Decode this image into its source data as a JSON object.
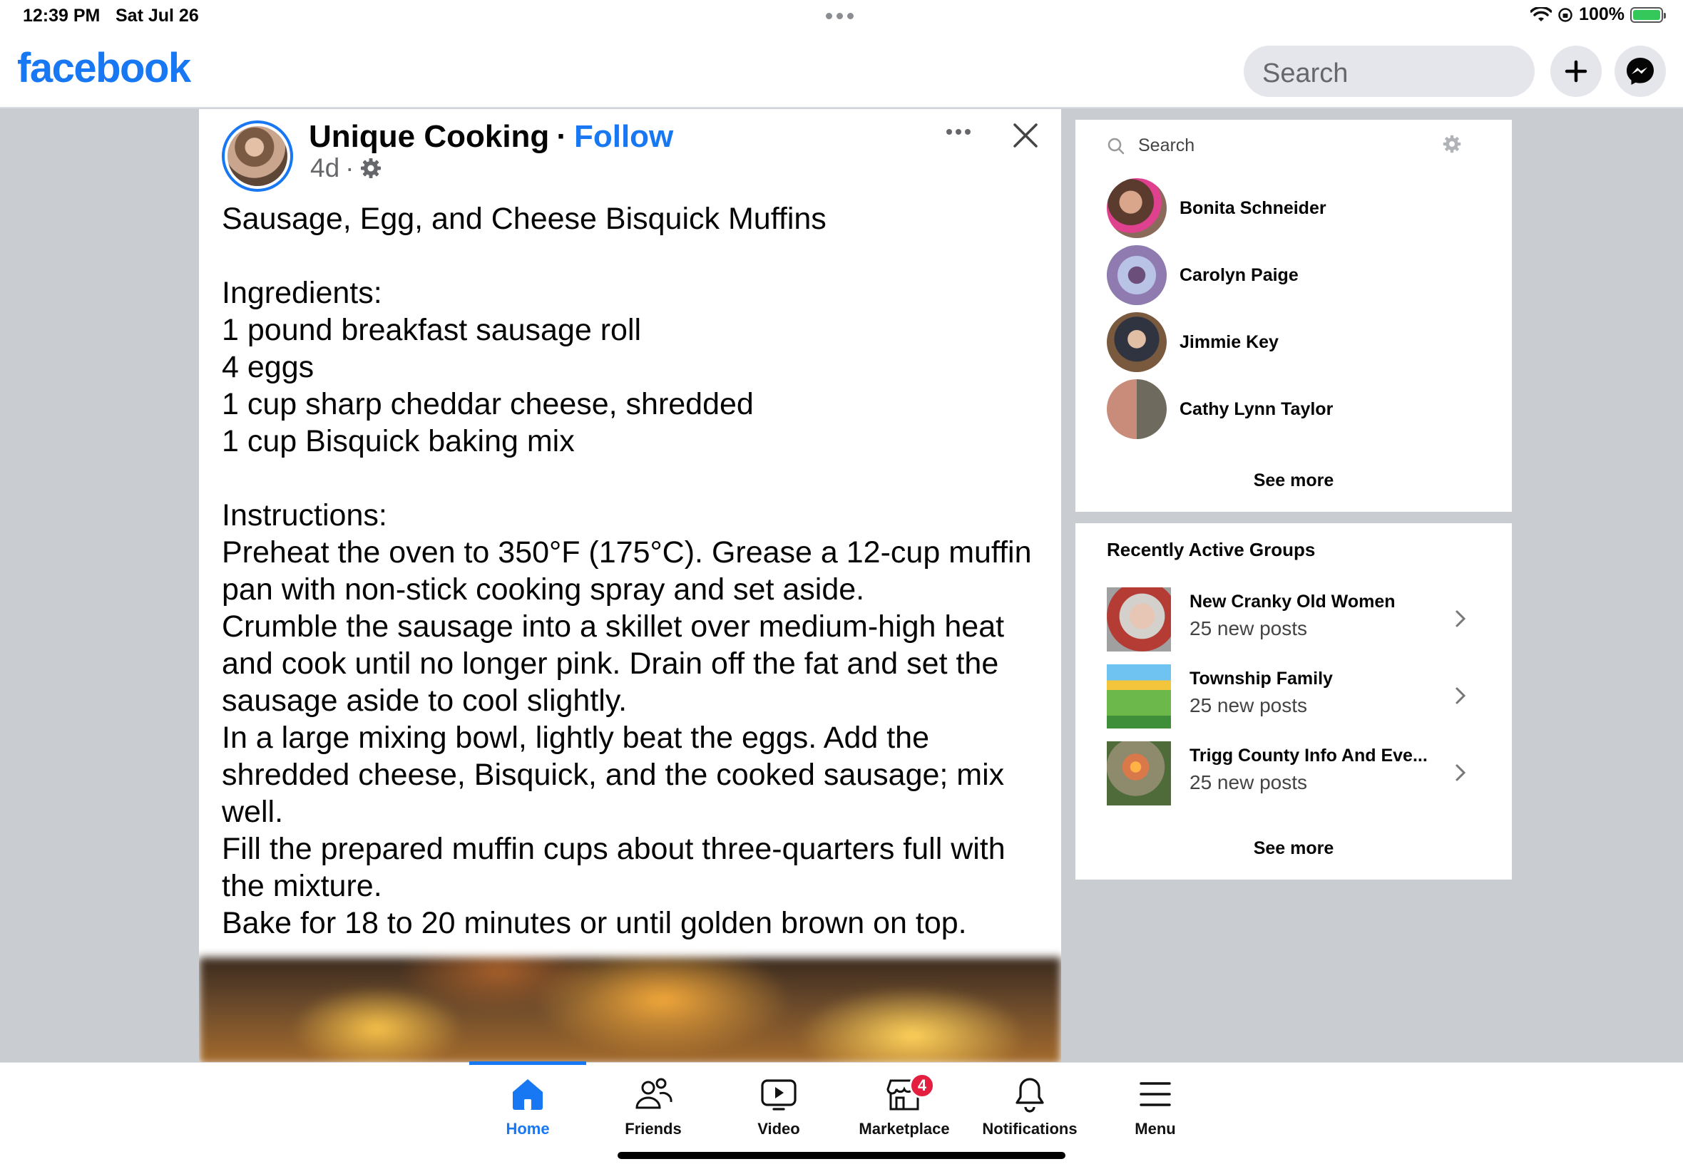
{
  "status_bar": {
    "time": "12:39 PM",
    "date": "Sat Jul 26",
    "battery": "100%"
  },
  "header": {
    "logo": "facebook",
    "search_placeholder": "Search",
    "add_icon": "plus-icon",
    "messenger_icon": "messenger-icon"
  },
  "post": {
    "page_name": "Unique Cooking",
    "separator": "·",
    "follow_label": "Follow",
    "age": "4d",
    "age_separator": "·",
    "text": "Sausage, Egg, and Cheese Bisquick Muffins\n\nIngredients:\n1 pound breakfast sausage roll\n4 eggs\n1 cup sharp cheddar cheese, shredded\n1 cup Bisquick baking mix\n\nInstructions:\nPreheat the oven to 350°F (175°C). Grease a 12-cup muffin pan with non-stick cooking spray and set aside.\nCrumble the sausage into a skillet over medium-high heat and cook until no longer pink. Drain off the fat and set the sausage aside to cool slightly.\nIn a large mixing bowl, lightly beat the eggs. Add the shredded cheese, Bisquick, and the cooked sausage; mix well.\nFill the prepared muffin cups about three-quarters full with the mixture.\nBake for 18 to 20 minutes or until golden brown on top."
  },
  "contacts": {
    "search_placeholder": "Search",
    "items": [
      {
        "name": "Bonita Schneider"
      },
      {
        "name": "Carolyn Paige"
      },
      {
        "name": "Jimmie Key"
      },
      {
        "name": "Cathy Lynn Taylor"
      }
    ],
    "see_more": "See more"
  },
  "groups": {
    "title": "Recently Active Groups",
    "items": [
      {
        "name": "New Cranky Old Women",
        "posts": "25 new posts"
      },
      {
        "name": "Township Family",
        "posts": "25 new posts"
      },
      {
        "name": "Trigg County Info And Eve...",
        "posts": "25 new posts"
      }
    ],
    "see_more": "See more"
  },
  "bottom_nav": {
    "items": [
      {
        "label": "Home",
        "icon": "home-icon",
        "active": true
      },
      {
        "label": "Friends",
        "icon": "friends-icon"
      },
      {
        "label": "Video",
        "icon": "video-icon"
      },
      {
        "label": "Marketplace",
        "icon": "marketplace-icon",
        "badge": "4"
      },
      {
        "label": "Notifications",
        "icon": "bell-icon"
      },
      {
        "label": "Menu",
        "icon": "menu-icon"
      }
    ]
  },
  "colors": {
    "brand": "#1877f2",
    "background": "#c9ccd1",
    "badge": "#e41e3f"
  }
}
